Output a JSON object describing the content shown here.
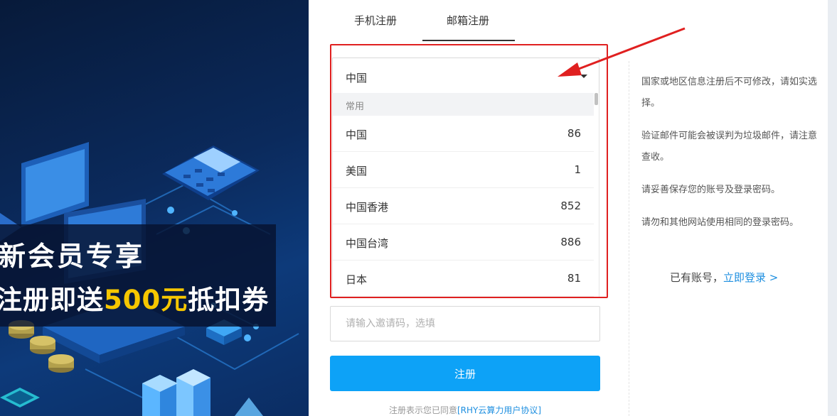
{
  "banner": {
    "headline": "新会员专享",
    "offer_prefix": "注册即送",
    "offer_amount": "500元",
    "offer_suffix": "抵扣券"
  },
  "tabs": [
    {
      "label": "手机注册",
      "active": false
    },
    {
      "label": "邮箱注册",
      "active": true
    }
  ],
  "country_select": {
    "selected": "中国",
    "group_label": "常用",
    "options": [
      {
        "name": "中国",
        "code": "86"
      },
      {
        "name": "美国",
        "code": "1"
      },
      {
        "name": "中国香港",
        "code": "852"
      },
      {
        "name": "中国台湾",
        "code": "886"
      },
      {
        "name": "日本",
        "code": "81"
      }
    ]
  },
  "invite": {
    "placeholder": "请输入邀请码，选填"
  },
  "register_button": "注册",
  "agreement": {
    "prefix": "注册表示您已同意",
    "link": "[RHY云算力用户协议]"
  },
  "notes": [
    "国家或地区信息注册后不可修改，请如实选择。",
    "验证邮件可能会被误判为垃圾邮件，请注意查收。",
    "请妥善保存您的账号及登录密码。",
    "请勿和其他网站使用相同的登录密码。"
  ],
  "login": {
    "prefix": "已有账号，",
    "link": "立即登录 >"
  },
  "colors": {
    "accent": "#0da2f7",
    "link": "#1e8fe0",
    "annotation_red": "#e02020",
    "banner_dark": "#071a3a",
    "promo_yellow": "#f6c700"
  }
}
